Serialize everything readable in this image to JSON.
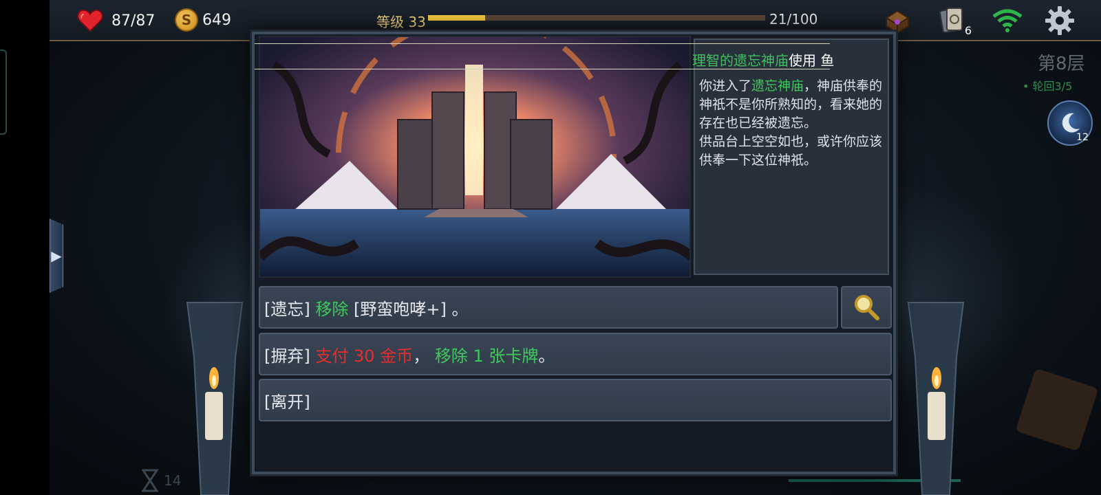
{
  "hud": {
    "hp": "87/87",
    "gold": "649",
    "level_label": "等级 33",
    "xp_text": "21/100",
    "xp_progress": 0.17,
    "deck_count": "6",
    "coin_letter": "S"
  },
  "side": {
    "floor": "第8层",
    "cycle": "• 轮回3/5",
    "moon_count": "12",
    "hourglass_count": "14"
  },
  "event": {
    "title_green": "理智的遗忘神庙",
    "title_white": "使用 鱼",
    "description": {
      "p1_prefix": "你进入了",
      "p1_highlight": "遗忘神庙",
      "p1_suffix": "，神庙供奉的神祇不是你所熟知的，看来她的存在也已经被遗忘。",
      "p2": "供品台上空空如也，或许你应该供奉一下这位神祇。"
    },
    "choices": [
      {
        "tag": "[遗忘]",
        "green": "移除",
        "rest": "[野蛮咆哮+]",
        "end": "。"
      },
      {
        "tag": "[摒弃]",
        "red": "支付 30 金币",
        "sep": "，",
        "green": "移除 1 张卡牌",
        "end": "。"
      },
      {
        "tag": "[离开]"
      }
    ]
  },
  "colors": {
    "green_text": "#3fca5c",
    "red_text": "#e42d2d",
    "xp_bar": "#f3c73e",
    "frame": "#3d4c5c"
  },
  "icons": {
    "hp": "heart-icon",
    "gold": "coin-icon",
    "treasure": "chest-icon",
    "deck": "card-deck-icon",
    "network": "wifi-icon",
    "settings": "gear-icon",
    "inspect": "magnifier-icon",
    "moon": "moon-icon",
    "hourglass": "hourglass-icon",
    "map": "map-icon",
    "side_toggle": "chevron-right-icon"
  }
}
